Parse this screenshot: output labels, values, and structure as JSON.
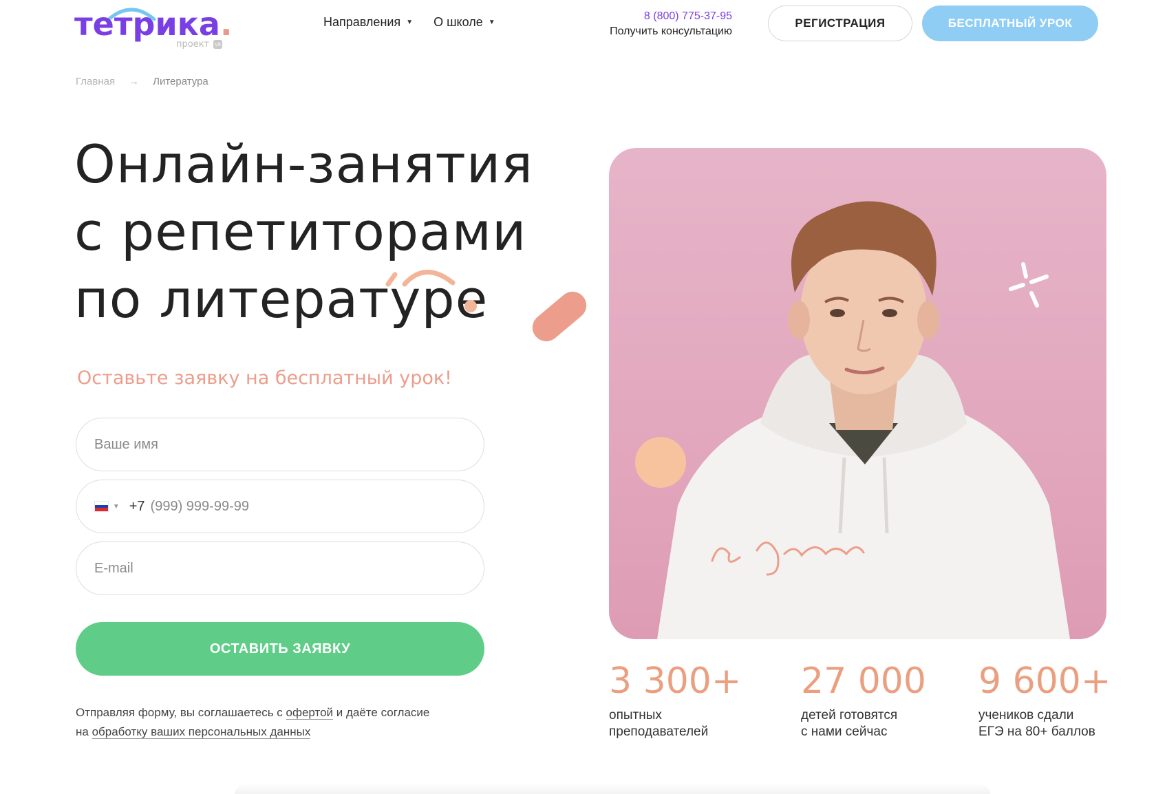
{
  "header": {
    "logo_text": "тетрика",
    "logo_sub": "проект",
    "logo_sub_badge": "vk",
    "nav": [
      {
        "label": "Направления"
      },
      {
        "label": "О школе"
      }
    ],
    "phone": "8 (800) 775-37-95",
    "consult": "Получить консультацию",
    "register_label": "РЕГИСТРАЦИЯ",
    "free_lesson_label": "БЕСПЛАТНЫЙ УРОК"
  },
  "breadcrumb": {
    "home": "Главная",
    "separator": "→",
    "current": "Литература"
  },
  "hero": {
    "title_line1": "Онлайн-занятия",
    "title_line2": "с репетиторами",
    "title_line3": "по литературе",
    "subtitle": "Оставьте заявку на бесплатный урок!"
  },
  "form": {
    "name_placeholder": "Ваше имя",
    "phone_prefix": "+7",
    "phone_placeholder": "(999) 999-99-99",
    "email_placeholder": "E-mail",
    "submit_label": "ОСТАВИТЬ ЗАЯВКУ",
    "consent_part1": "Отправляя форму, вы соглашаетесь с ",
    "consent_link1": "офертой",
    "consent_part2": " и даёте согласие",
    "consent_part3": "на ",
    "consent_link2": "обработку ваших персональных данных"
  },
  "stats": [
    {
      "number": "3 300+",
      "label_line1": "опытных",
      "label_line2": "преподавателей"
    },
    {
      "number": "27 000",
      "label_line1": "детей готовятся",
      "label_line2": "с нами сейчас"
    },
    {
      "number": "9 600+",
      "label_line1": "учеников сдали",
      "label_line2": "ЕГЭ на 80+ баллов"
    }
  ],
  "colors": {
    "brand_purple": "#7a3fe4",
    "accent_salmon": "#ec9d8b",
    "submit_green": "#5fcd88",
    "free_lesson_blue": "#8fcdf5",
    "photo_pink": "#e2a7bd"
  },
  "icons": {
    "nav_caret": "caret-down-icon",
    "phone_country": "russia-flag-icon",
    "sparkle": "sparkle-icon"
  }
}
